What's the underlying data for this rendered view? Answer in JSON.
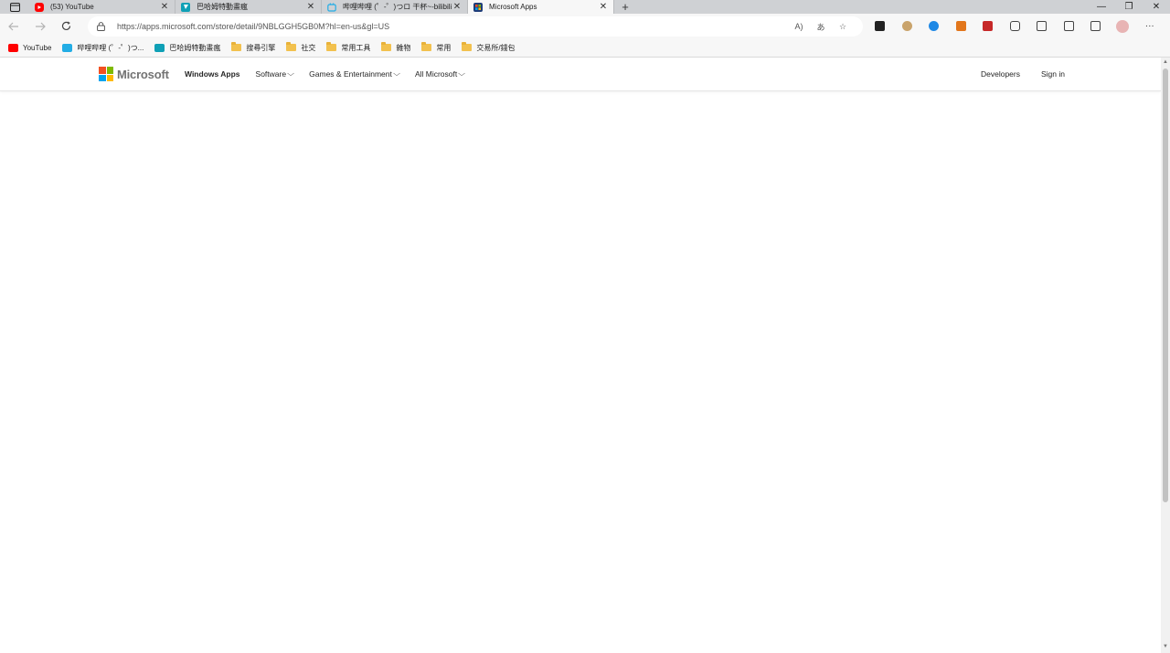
{
  "tabs": [
    {
      "title": "(53) YouTube",
      "icon": "youtube-icon",
      "color": "#ff0000"
    },
    {
      "title": "巴哈姆特動畫瘋",
      "icon": "bahamut-icon",
      "color": "#0fa0b6"
    },
    {
      "title": "哔哩哔哩 (゜-゜)つロ 干杯~-bilibili",
      "icon": "bilibili-icon",
      "color": "#23ade5"
    },
    {
      "title": "Microsoft Apps",
      "icon": "microsoft-store-icon",
      "color": "#1f3d7a"
    }
  ],
  "tab_close": "✕",
  "new_tab": "+",
  "window": {
    "minimize": "—",
    "restore": "❐",
    "close": "✕"
  },
  "address": {
    "url": "https://apps.microsoft.com/store/detail/9NBLGGH5GB0M?hl=en-us&gl=US",
    "read_aloud": "A)",
    "translate": "あ",
    "favorite": "☆"
  },
  "more_menu": "···",
  "bookmarks": [
    {
      "label": "YouTube",
      "type": "site",
      "color": "#ff0000"
    },
    {
      "label": "哔哩哔哩 (゜-゜)つ...",
      "type": "site",
      "color": "#23ade5"
    },
    {
      "label": "巴哈姆特動畫瘋",
      "type": "site",
      "color": "#0fa0b6"
    },
    {
      "label": "搜尋引擎",
      "type": "folder"
    },
    {
      "label": "社交",
      "type": "folder"
    },
    {
      "label": "常用工具",
      "type": "folder"
    },
    {
      "label": "雜物",
      "type": "folder"
    },
    {
      "label": "常用",
      "type": "folder"
    },
    {
      "label": "交易所/錢包",
      "type": "folder"
    }
  ],
  "site_header": {
    "brand": "Microsoft",
    "nav": [
      {
        "label": "Windows Apps",
        "bold": true,
        "dropdown": false
      },
      {
        "label": "Software",
        "bold": false,
        "dropdown": true
      },
      {
        "label": "Games & Entertainment",
        "bold": false,
        "dropdown": true
      },
      {
        "label": "All Microsoft",
        "bold": false,
        "dropdown": true
      }
    ],
    "right": [
      {
        "label": "Developers"
      },
      {
        "label": "Sign in"
      }
    ]
  },
  "chevron": "⌵",
  "extensions": [
    {
      "name": "extension-black-icon",
      "color": "#222222"
    },
    {
      "name": "extension-cookie-icon",
      "color": "#c9a36b"
    },
    {
      "name": "extension-shield-blue-icon",
      "color": "#1e88e5"
    },
    {
      "name": "extension-metamask-icon",
      "color": "#e2761b"
    },
    {
      "name": "extension-red-shield-icon",
      "color": "#c62828"
    },
    {
      "name": "extensions-puzzle-icon",
      "color": "#444444"
    },
    {
      "name": "collections-icon",
      "color": "#444444"
    },
    {
      "name": "downloads-icon",
      "color": "#444444"
    },
    {
      "name": "screenshot-icon",
      "color": "#444444"
    },
    {
      "name": "profile-avatar-icon",
      "color": "#e8b4b4"
    }
  ]
}
